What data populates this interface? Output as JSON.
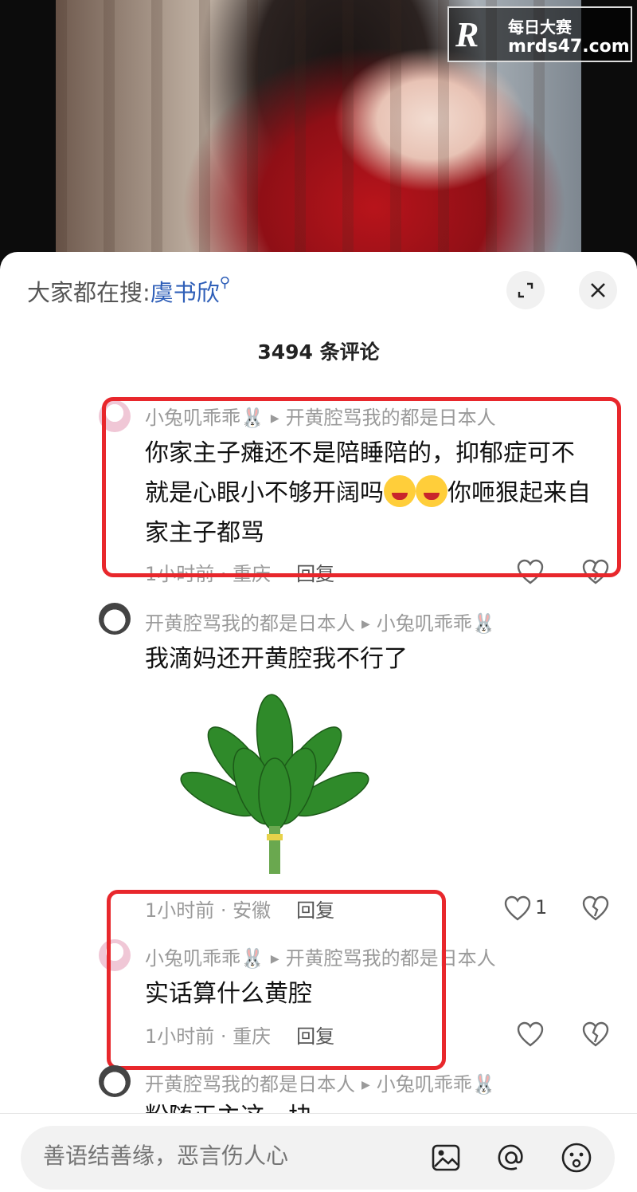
{
  "watermark": {
    "logo": "R",
    "title": "每日大赛",
    "url": "mrds47.com"
  },
  "header": {
    "search_prefix": "大家都在搜:",
    "search_keyword": "虞书欣",
    "comment_count": "3494 条评论"
  },
  "comments": [
    {
      "user": "小兔叽乖乖🐰",
      "reply_to": "开黄腔骂我的都是日本人",
      "line1": "你家主子瘫还不是陪睡陪的，抑郁症可不",
      "line2_a": "就是心眼小不够开阔吗",
      "line2_b": "你咂狠起来自",
      "line3": "家主子都骂",
      "time": "1小时前 · 重庆",
      "reply_label": "回复"
    },
    {
      "user": "开黄腔骂我的都是日本人",
      "reply_to": "小兔叽乖乖🐰",
      "text": "我滴妈还开黄腔我不行了",
      "time": "1小时前 · 安徽",
      "reply_label": "回复",
      "likes": "1"
    },
    {
      "user": "小兔叽乖乖🐰",
      "reply_to": "开黄腔骂我的都是日本人",
      "text": "实话算什么黄腔",
      "time": "1小时前 · 重庆",
      "reply_label": "回复"
    },
    {
      "user": "开黄腔骂我的都是日本人",
      "reply_to": "小兔叽乖乖🐰",
      "text": "粉随正主这一块"
    }
  ],
  "input": {
    "placeholder": "善语结善缘，恶言伤人心"
  },
  "icons": [
    "expand-icon",
    "close-icon",
    "heart-icon",
    "broken-heart-icon",
    "image-icon",
    "at-icon",
    "emoji-icon"
  ],
  "colors": {
    "highlight_box": "#e8272c",
    "keyword": "#2f5fb8"
  }
}
